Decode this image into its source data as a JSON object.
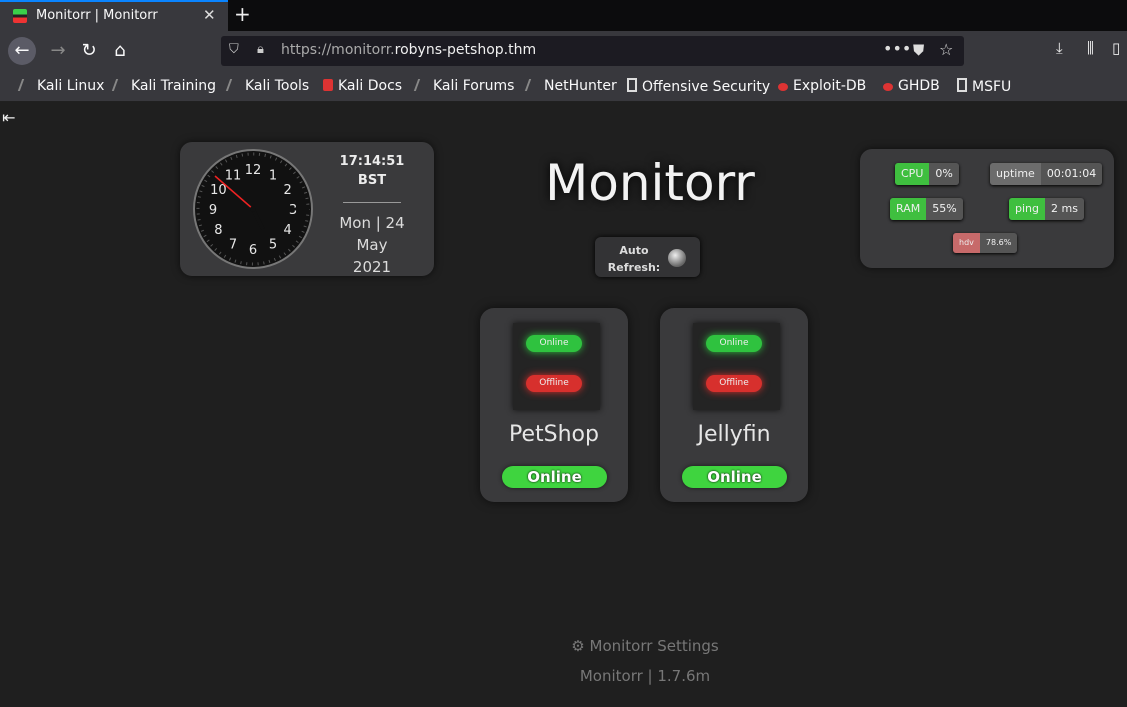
{
  "browser": {
    "tab_title": "Monitorr | Monitorr",
    "url_prefix": "https://monitorr.",
    "url_host": "robyns-petshop.thm",
    "bookmarks": [
      "Kali Linux",
      "Kali Training",
      "Kali Tools",
      "Kali Docs",
      "Kali Forums",
      "NetHunter",
      "Offensive Security",
      "Exploit-DB",
      "GHDB",
      "MSFU"
    ]
  },
  "clock": {
    "time": "17:14:51",
    "timezone": "BST",
    "date_line1": "Mon | 24",
    "date_line2": "May",
    "date_line3": "2021",
    "numerals": [
      "12",
      "1",
      "2",
      "3",
      "4",
      "5",
      "6",
      "7",
      "8",
      "9",
      "10",
      "11"
    ]
  },
  "app": {
    "title": "Monitorr",
    "auto_refresh_label_1": "Auto",
    "auto_refresh_label_2": "Refresh:"
  },
  "stats": {
    "cpu_label": "CPU",
    "cpu_value": "0%",
    "uptime_label": "uptime",
    "uptime_value": "00:01:04",
    "ram_label": "RAM",
    "ram_value": "55%",
    "ping_label": "ping",
    "ping_value": "2 ms",
    "hd_label": "hdv",
    "hd_value": "78.6%"
  },
  "services": [
    {
      "name": "PetShop",
      "status": "Online",
      "thumb_online": "Online",
      "thumb_offline": "Offline"
    },
    {
      "name": "Jellyfin",
      "status": "Online",
      "thumb_online": "Online",
      "thumb_offline": "Offline"
    }
  ],
  "footer": {
    "settings_icon": "gear-icon",
    "settings_label": "Monitorr Settings",
    "version": "Monitorr | 1.7.6m"
  },
  "colors": {
    "online": "#3fd43f",
    "offline": "#d7302d",
    "accent": "#0a84ff"
  }
}
